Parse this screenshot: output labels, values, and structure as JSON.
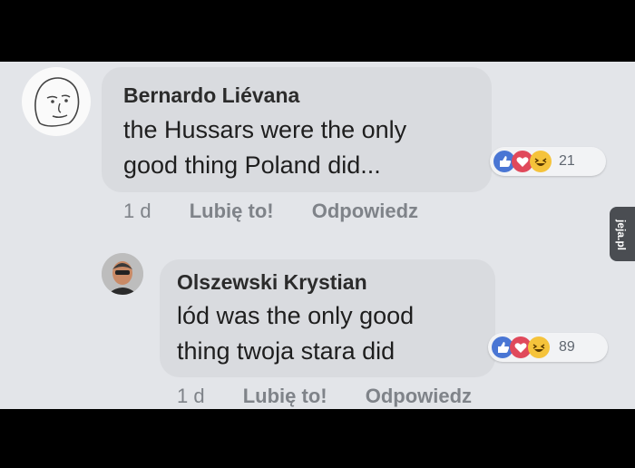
{
  "comments": [
    {
      "author": "Bernardo Liévana",
      "text_lines": [
        "the Hussars were the only",
        "good thing Poland did..."
      ],
      "reaction_count": "21",
      "time": "1 d",
      "like_label": "Lubię to!",
      "reply_label": "Odpowiedz"
    },
    {
      "author": "Olszewski Krystian",
      "text_lines": [
        "lód was the only good",
        "thing twoja stara did"
      ],
      "reaction_count": "89",
      "time": "1 d",
      "like_label": "Lubię to!",
      "reply_label": "Odpowiedz"
    }
  ],
  "watermark": "jeja.pl",
  "reaction_icons": [
    "like-icon",
    "love-icon",
    "haha-icon"
  ],
  "colors": {
    "like": "#4a76d4",
    "love": "#e0495b",
    "haha": "#f5c33b"
  }
}
